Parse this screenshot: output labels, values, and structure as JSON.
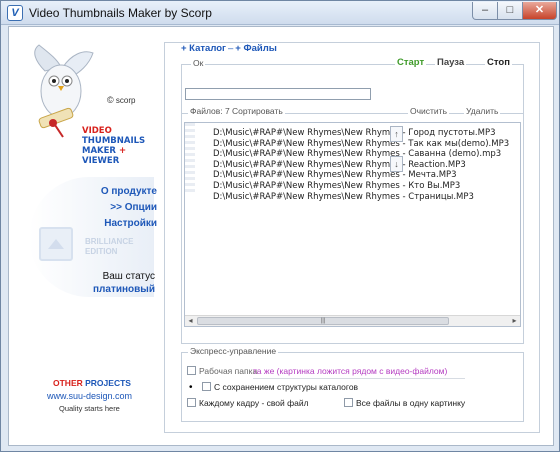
{
  "window": {
    "title": "Video Thumbnails Maker by Scorp",
    "controls": {
      "min": "–",
      "max": "□",
      "close": "✕"
    },
    "accent": "#1d57b8",
    "brand_red": "#d8211c"
  },
  "left": {
    "scorp": "scorp",
    "logo": {
      "line1": "VIDEO",
      "line2": "THUMBNAILS",
      "line3a": "MAKER",
      "line3plus": "+",
      "line3b": "VIEWER"
    },
    "menu": [
      "О продукте",
      ">> Опции",
      "Настройки"
    ],
    "edition": {
      "line1": "BRILLIANCE",
      "line2": "EDITION"
    },
    "status_label": "Ваш статус",
    "status_value": "платиновый",
    "other": {
      "a": "OTHER",
      "b": "PROJECTS"
    },
    "site": "www.suu-design.com",
    "slogan": "Quality starts here"
  },
  "right": {
    "tabs": {
      "catalog": "+ Каталог",
      "files": "+ Файлы"
    },
    "ok_label": "Ок",
    "controls": {
      "start": "Старт",
      "pause": "Пауза",
      "stop": "Стоп"
    },
    "files_label": "Файлов: 7",
    "actions": {
      "sort": "Сортировать",
      "clear": "Очистить",
      "delete": "Удалить"
    },
    "files": [
      "D:\\Music\\#RAP#\\New Rhymes\\New Rhymes - Город пустоты.MP3",
      "D:\\Music\\#RAP#\\New Rhymes\\New Rhymes - Так как мы(demo).MP3",
      "D:\\Music\\#RAP#\\New Rhymes\\New Rhymes - Саванна (demo).mp3",
      "D:\\Music\\#RAP#\\New Rhymes\\New Rhymes - Reaction.MP3",
      "D:\\Music\\#RAP#\\New Rhymes\\New Rhymes - Мечта.MP3",
      "D:\\Music\\#RAP#\\New Rhymes\\New Rhymes - Кто Вы.MP3",
      "D:\\Music\\#RAP#\\New Rhymes\\New Rhymes - Страницы.MP3"
    ],
    "scroll": {
      "left": "◂",
      "right": "▸",
      "grip": "|||",
      "up": "↑",
      "down": "↓"
    },
    "express": {
      "label": "Экспресс-управление",
      "work_folder": "Рабочая папка",
      "work_folder_value": "та же (картинка ложится рядом с видео-файлом)",
      "bullet": "•",
      "keep_structure": "С сохранением структуры каталогов",
      "each_frame": "Каждому кадру - свой файл",
      "all_files": "Все файлы в одну картинку"
    }
  }
}
